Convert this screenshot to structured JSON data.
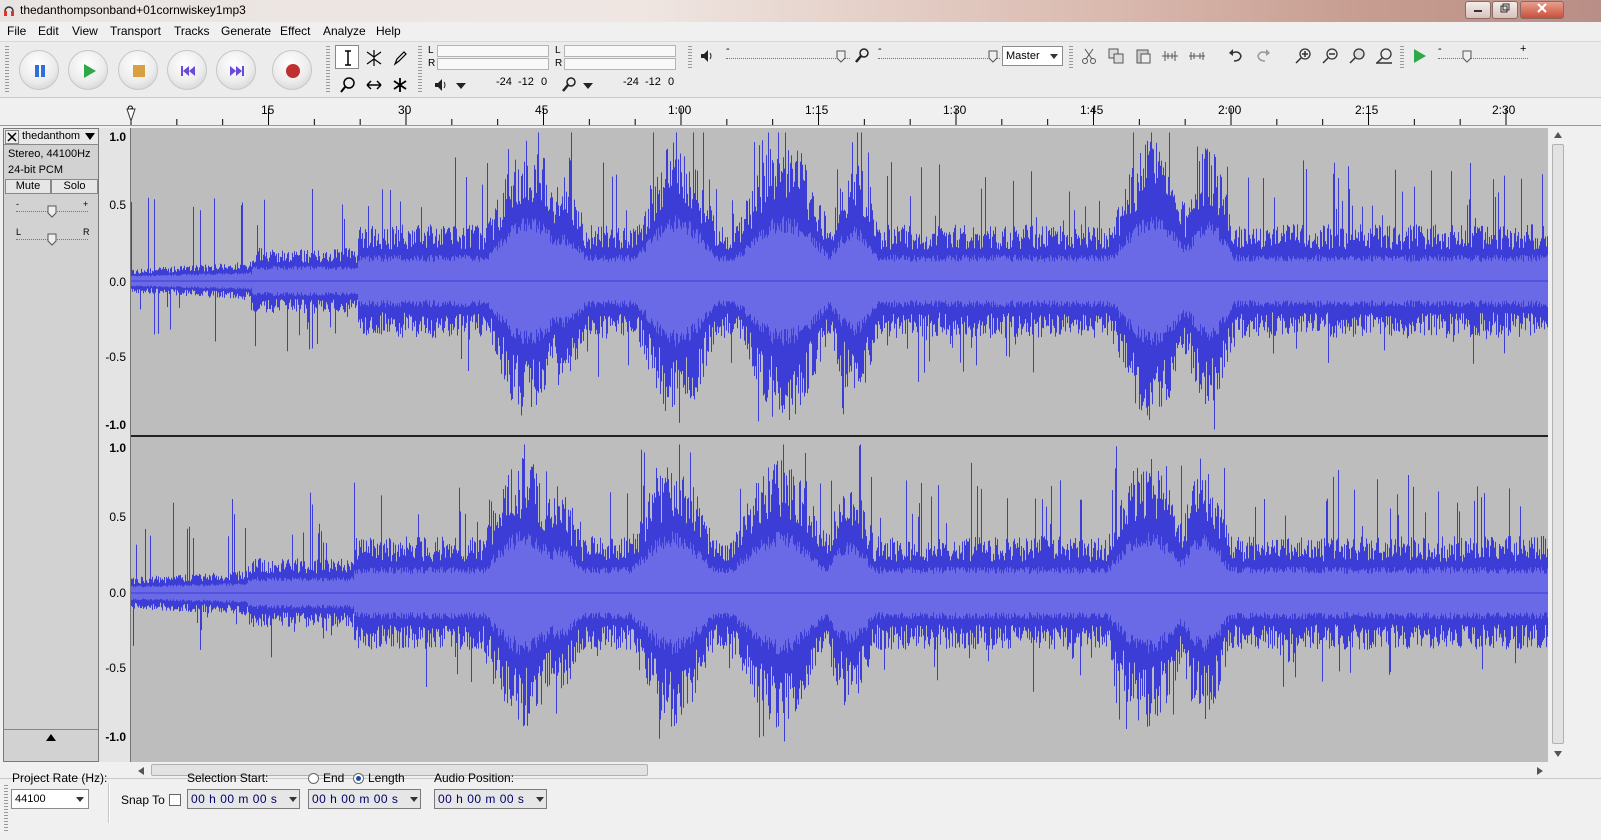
{
  "window": {
    "title": "thedanthompsonband+01cornwiskey1mp3"
  },
  "menu": [
    "File",
    "Edit",
    "View",
    "Transport",
    "Tracks",
    "Generate",
    "Effect",
    "Analyze",
    "Help"
  ],
  "meters": {
    "playback": {
      "left": "L",
      "right": "R",
      "scale": [
        "-24",
        "-12",
        "0"
      ]
    },
    "record": {
      "left": "L",
      "right": "R",
      "scale": [
        "-24",
        "-12",
        "0"
      ]
    }
  },
  "mixer": {
    "input_source": "Master"
  },
  "ruler": {
    "ticks": [
      "0",
      "15",
      "30",
      "45",
      "1:00",
      "1:15",
      "1:30",
      "1:45",
      "2:00",
      "2:15",
      "2:30"
    ]
  },
  "track": {
    "name": "thedanthom",
    "info_line1": "Stereo, 44100Hz",
    "info_line2": "24-bit PCM",
    "mute_label": "Mute",
    "solo_label": "Solo",
    "gain_minus": "-",
    "gain_plus": "+",
    "pan_left": "L",
    "pan_right": "R",
    "scale_top": [
      "1.0",
      "0.5",
      "0.0",
      "-0.5",
      "-1.0"
    ],
    "scale_bottom": [
      "1.0",
      "0.5",
      "0.0",
      "-0.5",
      "-1.0"
    ],
    "wave_color": "#3c3cd6",
    "wave_rms_color": "#6a6ae6"
  },
  "selection": {
    "project_rate_label": "Project Rate (Hz):",
    "project_rate_value": "44100",
    "snap_to_label": "Snap To",
    "selection_start_label": "Selection Start:",
    "end_label": "End",
    "length_label": "Length",
    "audio_position_label": "Audio Position:",
    "start_value": "00 h 00 m 00 s",
    "length_value": "00 h 00 m 00 s",
    "position_value": "00 h 00 m 00 s"
  }
}
